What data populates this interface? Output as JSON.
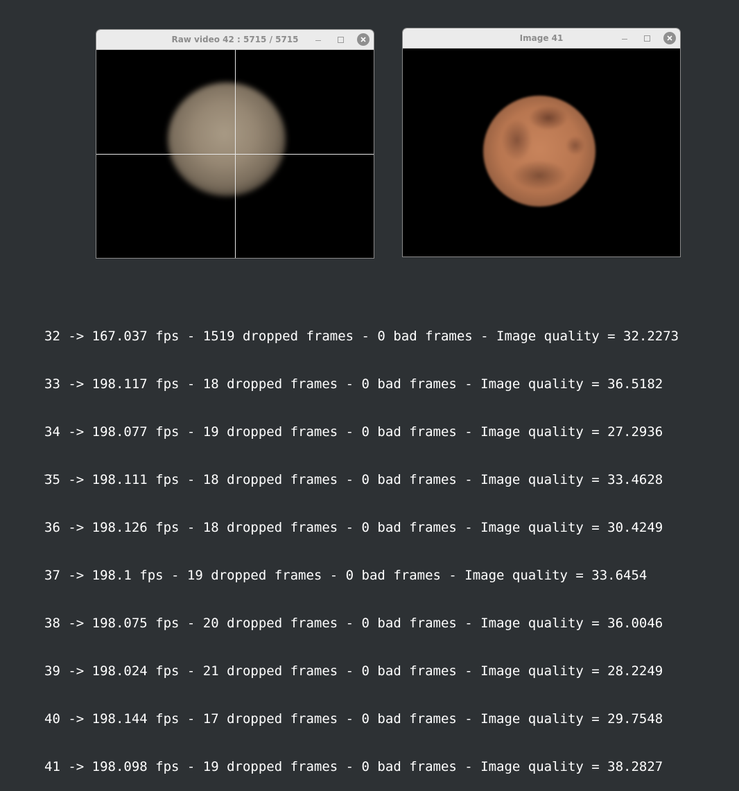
{
  "windows": [
    {
      "title": "Raw video 42 :  5715 /  5715",
      "minimize": "minimize",
      "maximize": "maximize",
      "close": "close"
    },
    {
      "title": "Image 41",
      "minimize": "minimize",
      "maximize": "maximize",
      "close": "close"
    }
  ],
  "console": {
    "lines": [
      "32 -> 167.037 fps - 1519 dropped frames - 0 bad frames - Image quality = 32.2273",
      "33 -> 198.117 fps - 18 dropped frames - 0 bad frames - Image quality = 36.5182",
      "34 -> 198.077 fps - 19 dropped frames - 0 bad frames - Image quality = 27.2936",
      "35 -> 198.111 fps - 18 dropped frames - 0 bad frames - Image quality = 33.4628",
      "36 -> 198.126 fps - 18 dropped frames - 0 bad frames - Image quality = 30.4249",
      "37 -> 198.1 fps - 19 dropped frames - 0 bad frames - Image quality = 33.6454",
      "38 -> 198.075 fps - 20 dropped frames - 0 bad frames - Image quality = 36.0046",
      "39 -> 198.024 fps - 21 dropped frames - 0 bad frames - Image quality = 28.2249",
      "40 -> 198.144 fps - 17 dropped frames - 0 bad frames - Image quality = 29.7548",
      "41 -> 198.098 fps - 19 dropped frames - 0 bad frames - Image quality = 38.2827"
    ],
    "cursor": "_"
  },
  "colors": {
    "background": "#2d3134",
    "titlebar": "#ebebeb",
    "title_text": "#8c8c8c",
    "console_text": "#ffffff",
    "crosshair": "#e8e8e8"
  }
}
